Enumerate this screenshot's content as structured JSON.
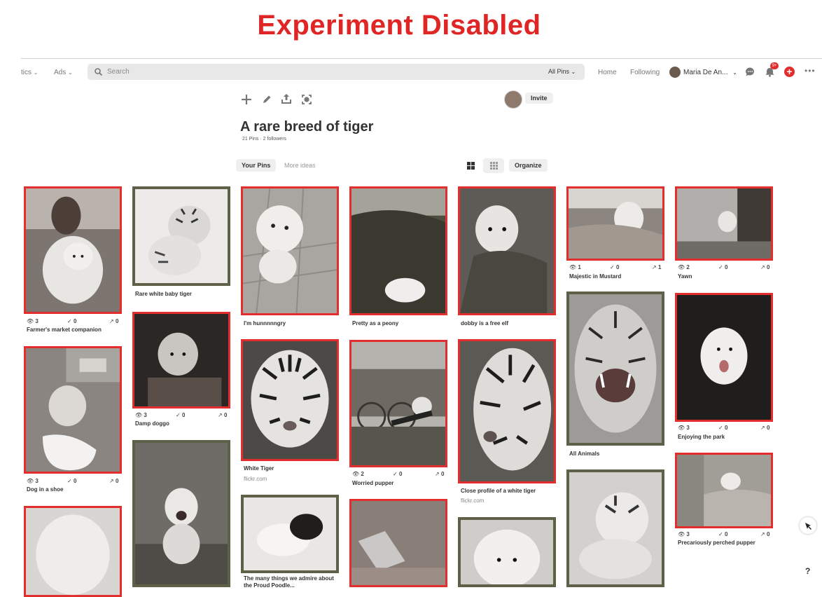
{
  "banner": "Experiment Disabled",
  "topnav": {
    "analytics_label": "tics",
    "ads_label": "Ads",
    "search_placeholder": "Search",
    "scope_label": "All Pins",
    "home_label": "Home",
    "following_label": "Following",
    "user_name": "Maria De An...",
    "notification_count": "9+"
  },
  "board": {
    "invite_label": "Invite",
    "title": "A rare breed of tiger",
    "stats": "21 Pins · 2 followers",
    "tabs": [
      "Your Pins",
      "More ideas"
    ],
    "organize_label": "Organize"
  },
  "pins": [
    {
      "caption": "Farmer's market companion",
      "views": "3",
      "saves": "0",
      "clicks": "0"
    },
    {
      "caption": "Dog in a shoe",
      "views": "3",
      "saves": "0",
      "clicks": "0"
    },
    {
      "caption": "Rare white baby tiger"
    },
    {
      "caption": "Damp doggo",
      "views": "3",
      "saves": "0",
      "clicks": "0"
    },
    {
      "caption": "I'm hunnnnngry"
    },
    {
      "caption": "White Tiger",
      "source": "flickr.com"
    },
    {
      "caption": "The many things we admire about the Proud Poodle..."
    },
    {
      "caption": "Pretty as a peony"
    },
    {
      "caption": "Worried pupper",
      "views": "2",
      "saves": "0",
      "clicks": "0"
    },
    {
      "caption": "dobby is a free elf"
    },
    {
      "caption": "Close profile of a white tiger",
      "source": "flickr.com"
    },
    {
      "caption": "Majestic in Mustard",
      "views": "1",
      "saves": "0",
      "clicks": "1"
    },
    {
      "caption": "All Animals"
    },
    {
      "caption": "Yawn",
      "views": "2",
      "saves": "0",
      "clicks": "0"
    },
    {
      "caption": "Enjoying the park",
      "views": "3",
      "saves": "0",
      "clicks": "0"
    },
    {
      "caption": "Precariously perched pupper",
      "views": "3",
      "saves": "0",
      "clicks": "0"
    }
  ],
  "help_label": "?",
  "colors": {
    "accent": "#e42d2d",
    "banner": "#e02525",
    "frame_olive": "#5f6048"
  }
}
